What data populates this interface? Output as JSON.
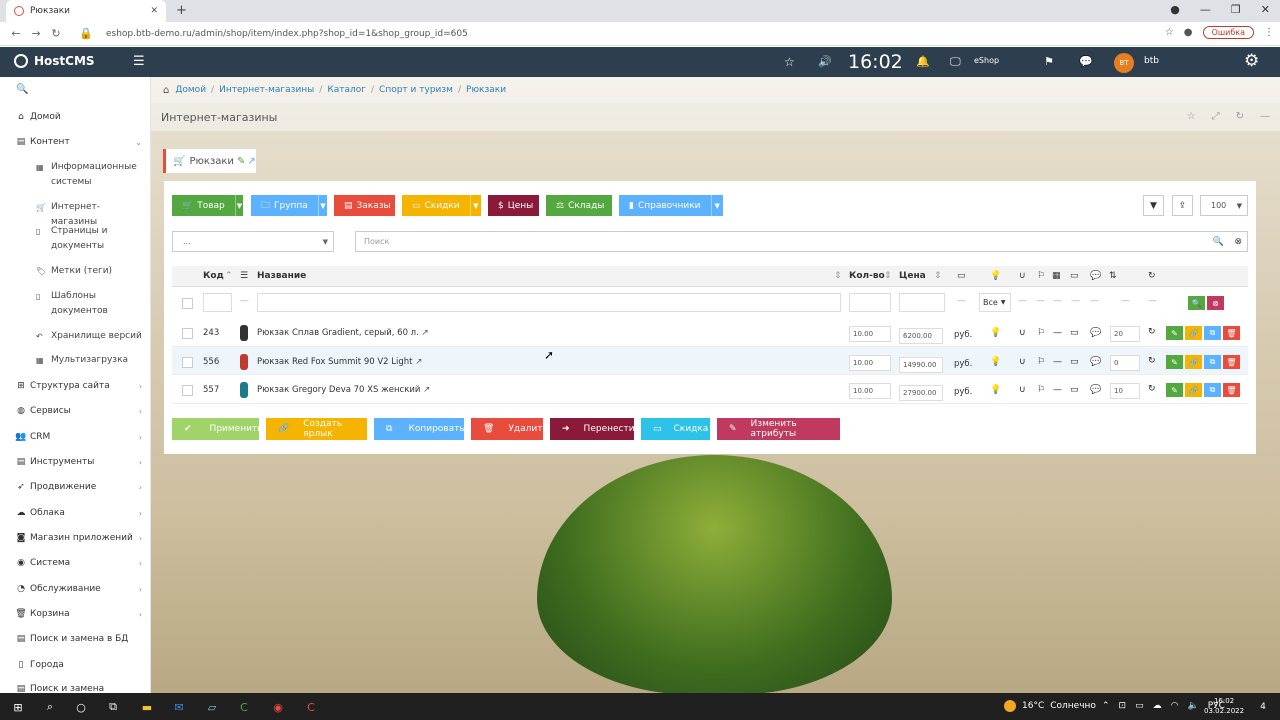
{
  "browser": {
    "tab_title": "Рюкзаки",
    "url": "eshop.btb-demo.ru/admin/shop/item/index.php?shop_id=1&shop_group_id=605",
    "error_label": "Ошибка"
  },
  "topbar": {
    "logo": "HostCMS",
    "time": "16:02",
    "site": "eShop",
    "avatar_initials": "BT",
    "user": "btb"
  },
  "sidebar": {
    "items": [
      {
        "label": "Домой",
        "icon": "home-icon"
      },
      {
        "label": "Контент",
        "icon": "content-icon"
      },
      {
        "label": "Структура сайта",
        "icon": "sitemap-icon"
      },
      {
        "label": "Сервисы",
        "icon": "globe-icon"
      },
      {
        "label": "CRM",
        "icon": "users-icon"
      },
      {
        "label": "Инструменты",
        "icon": "tools-icon"
      },
      {
        "label": "Продвижение",
        "icon": "rocket-icon"
      },
      {
        "label": "Облака",
        "icon": "cloud-icon"
      },
      {
        "label": "Магазин приложений",
        "icon": "shopping-bag-icon"
      },
      {
        "label": "Система",
        "icon": "db-icon"
      },
      {
        "label": "Обслуживание",
        "icon": "wrench-icon"
      },
      {
        "label": "Корзина",
        "icon": "trash-icon"
      },
      {
        "label": "Поиск и замена в БД",
        "icon": "search-replace-icon"
      },
      {
        "label": "Города",
        "icon": "city-icon"
      },
      {
        "label": "Поиск и замена",
        "icon": "search-replace-icon"
      }
    ],
    "subitems": [
      {
        "label1": "Информационные",
        "label2": "системы"
      },
      {
        "label1": "Интернет-магазины",
        "label2": ""
      },
      {
        "label1": "Страницы и",
        "label2": "документы"
      },
      {
        "label1": "Метки (теги)",
        "label2": ""
      },
      {
        "label1": "Шаблоны",
        "label2": "документов"
      },
      {
        "label1": "Хранилище версий",
        "label2": ""
      },
      {
        "label1": "Мультизагрузка",
        "label2": ""
      }
    ]
  },
  "breadcrumb": [
    "Домой",
    "Интернет-магазины",
    "Каталог",
    "Спорт и туризм",
    "Рюкзаки"
  ],
  "page_title": "Интернет-магазины",
  "section_tab": "Рюкзаки",
  "toolbar": {
    "buttons": [
      "Товар",
      "Группа",
      "Заказы",
      "Скидки",
      "Цены",
      "Склады",
      "Справочники"
    ],
    "per_page": "100",
    "group_select": "...",
    "search_placeholder": "Поиск",
    "colors": {
      "tovar": "#53a93f",
      "gruppa": "#5db2ff",
      "zakazy": "#e74c3c",
      "skidki": "#f4b400",
      "tseny": "#8b1a3a",
      "sklady": "#53a93f",
      "spravochniki": "#5db2ff"
    }
  },
  "table": {
    "headers": {
      "code": "Код",
      "name": "Название",
      "qty": "Кол-во",
      "price": "Цена"
    },
    "filter": {
      "dash": "—",
      "all_option": "Все"
    },
    "rows": [
      {
        "code": "243",
        "name": "Рюкзак Сплав Gradient, серый, 60 л.",
        "qty": "10.00",
        "price": "6200.00",
        "currency": "руб.",
        "sort": "20",
        "thumb_color": "#333333"
      },
      {
        "code": "556",
        "name": "Рюкзак Red Fox Summit 90 V2 Light",
        "qty": "10.00",
        "price": "14990.00",
        "currency": "руб.",
        "sort": "0",
        "thumb_color": "#c0392b"
      },
      {
        "code": "557",
        "name": "Рюкзак Gregory Deva 70 XS женский",
        "qty": "10.00",
        "price": "27900.00",
        "currency": "руб.",
        "sort": "10",
        "thumb_color": "#1d7a8a"
      }
    ],
    "row_dash": "—"
  },
  "bottom_buttons": [
    "Применить",
    "Создать ярлык",
    "Копировать",
    "Удалить",
    "Перенести",
    "Скидка",
    "Изменить атрибуты"
  ],
  "taskbar": {
    "temperature": "16°C",
    "weather": "Солнечно",
    "lang": "РУС",
    "time": "16:02",
    "date": "03.02.2022",
    "notifications": "4"
  }
}
